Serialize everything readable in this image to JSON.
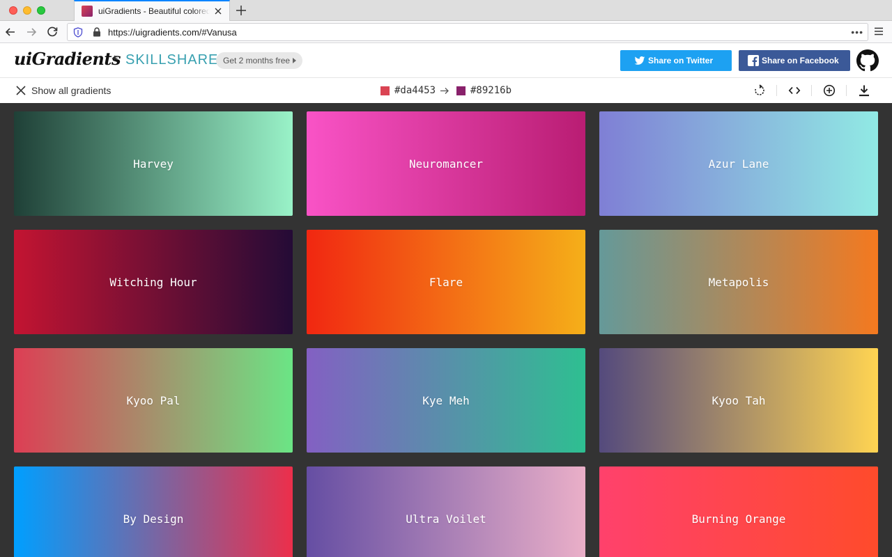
{
  "browser": {
    "tab_title": "uiGradients - Beautiful colored gradients",
    "url": "https://uigradients.com/#Vanusa",
    "more_label": "•••"
  },
  "header": {
    "logo": "uiGradients",
    "plus": "+",
    "partner": "SKILLSHARE",
    "promo": "Get 2 months free",
    "twitter_label": "Share on Twitter",
    "facebook_label": "Share on Facebook"
  },
  "toolbar": {
    "show_all_label": "Show all gradients",
    "color_from": "#da4453",
    "color_to": "#89216b",
    "icons": [
      "rotate-icon",
      "code-icon",
      "add-icon",
      "download-icon"
    ]
  },
  "gradients": [
    {
      "name": "Harvey",
      "from": "#1f4037",
      "to": "#99f2c8"
    },
    {
      "name": "Neuromancer",
      "from": "#f953c6",
      "to": "#b91d73"
    },
    {
      "name": "Azur Lane",
      "from": "#7f7fd5",
      "to": "#91eae4"
    },
    {
      "name": "Witching Hour",
      "from": "#c31432",
      "to": "#240b36"
    },
    {
      "name": "Flare",
      "from": "#f12711",
      "to": "#f5af19"
    },
    {
      "name": "Metapolis",
      "from": "#659999",
      "to": "#f4791f"
    },
    {
      "name": "Kyoo Pal",
      "from": "#dd3e54",
      "to": "#6be585"
    },
    {
      "name": "Kye Meh",
      "from": "#8360c3",
      "to": "#2ebf91"
    },
    {
      "name": "Kyoo Tah",
      "from": "#544a7d",
      "to": "#ffd452"
    },
    {
      "name": "By Design",
      "from": "#009fff",
      "to": "#ec2f4b"
    },
    {
      "name": "Ultra Voilet",
      "from": "#654ea3",
      "to": "#eaafc8"
    },
    {
      "name": "Burning Orange",
      "from": "#ff416c",
      "to": "#ff4b2b"
    }
  ]
}
